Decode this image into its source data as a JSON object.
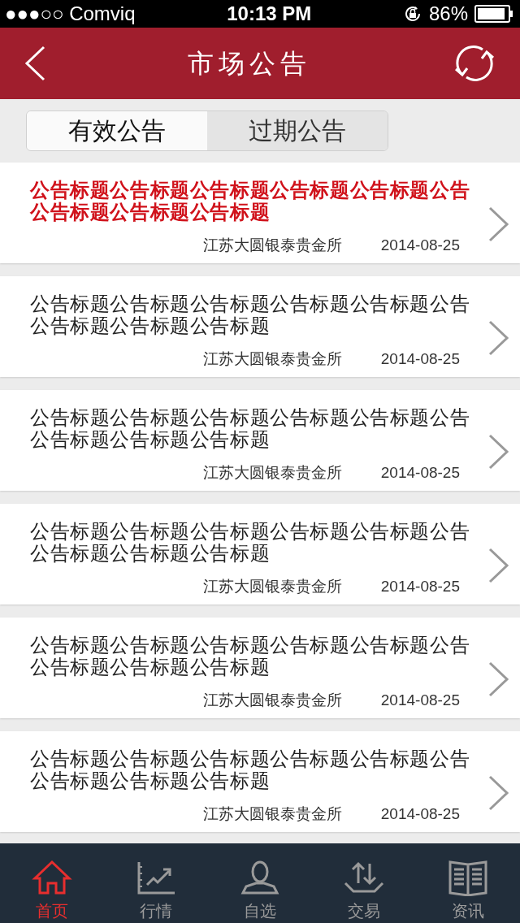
{
  "status_bar": {
    "carrier": "●●●○○ Comviq",
    "time": "10:13 PM",
    "battery": "86%"
  },
  "header": {
    "title": "市场公告"
  },
  "tabs": [
    {
      "label": "有效公告",
      "selected": true
    },
    {
      "label": "过期公告",
      "selected": false
    }
  ],
  "notices": [
    {
      "title": "公告标题公告标题公告标题公告标题公告标题公告公告标题公告标题公告标题",
      "source": "江苏大圆银泰贵金所",
      "date": "2014-08-25",
      "highlighted": true
    },
    {
      "title": "公告标题公告标题公告标题公告标题公告标题公告公告标题公告标题公告标题",
      "source": "江苏大圆银泰贵金所",
      "date": "2014-08-25",
      "highlighted": false
    },
    {
      "title": "公告标题公告标题公告标题公告标题公告标题公告公告标题公告标题公告标题",
      "source": "江苏大圆银泰贵金所",
      "date": "2014-08-25",
      "highlighted": false
    },
    {
      "title": "公告标题公告标题公告标题公告标题公告标题公告公告标题公告标题公告标题",
      "source": "江苏大圆银泰贵金所",
      "date": "2014-08-25",
      "highlighted": false
    },
    {
      "title": "公告标题公告标题公告标题公告标题公告标题公告公告标题公告标题公告标题",
      "source": "江苏大圆银泰贵金所",
      "date": "2014-08-25",
      "highlighted": false
    },
    {
      "title": "公告标题公告标题公告标题公告标题公告标题公告公告标题公告标题公告标题",
      "source": "江苏大圆银泰贵金所",
      "date": "2014-08-25",
      "highlighted": false
    }
  ],
  "bottom_nav": [
    {
      "kind": "home",
      "label": "首页",
      "selected": true
    },
    {
      "kind": "chart",
      "label": "行情",
      "selected": false
    },
    {
      "kind": "person",
      "label": "自选",
      "selected": false
    },
    {
      "kind": "trade",
      "label": "交易",
      "selected": false
    },
    {
      "kind": "book",
      "label": "资讯",
      "selected": false
    }
  ]
}
